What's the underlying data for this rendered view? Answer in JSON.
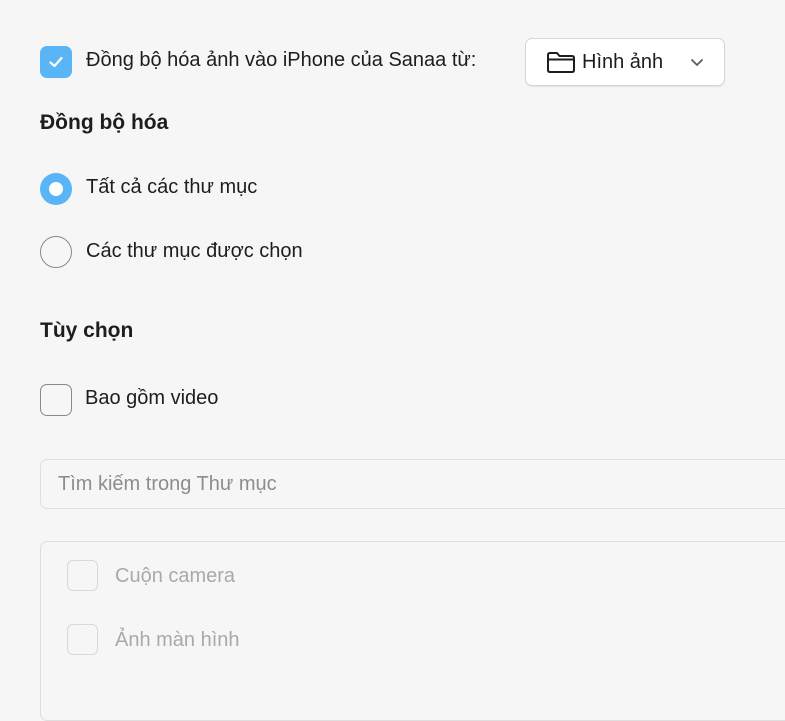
{
  "sync_photos": {
    "label": "Đồng bộ hóa ảnh vào iPhone của Sanaa từ:",
    "checked": true,
    "source": {
      "icon": "folder-icon",
      "value": "Hình ảnh",
      "chevron": "chevron-down-icon"
    }
  },
  "sync_section": {
    "heading": "Đồng bộ hóa",
    "options": [
      {
        "label": "Tất cả các thư mục",
        "selected": true
      },
      {
        "label": "Các thư mục được chọn",
        "selected": false
      }
    ]
  },
  "options_section": {
    "heading": "Tùy chọn",
    "include_video": {
      "label": "Bao gồm video",
      "checked": false
    }
  },
  "folder_search": {
    "placeholder": "Tìm kiếm trong Thư mục"
  },
  "folders": [
    {
      "label": "Cuộn camera",
      "checked": false,
      "enabled": false
    },
    {
      "label": "Ảnh màn hình",
      "checked": false,
      "enabled": false
    }
  ],
  "colors": {
    "accent": "#5ab5f7",
    "background": "#f6f6f6",
    "disabled_text": "#a9a9a9"
  }
}
